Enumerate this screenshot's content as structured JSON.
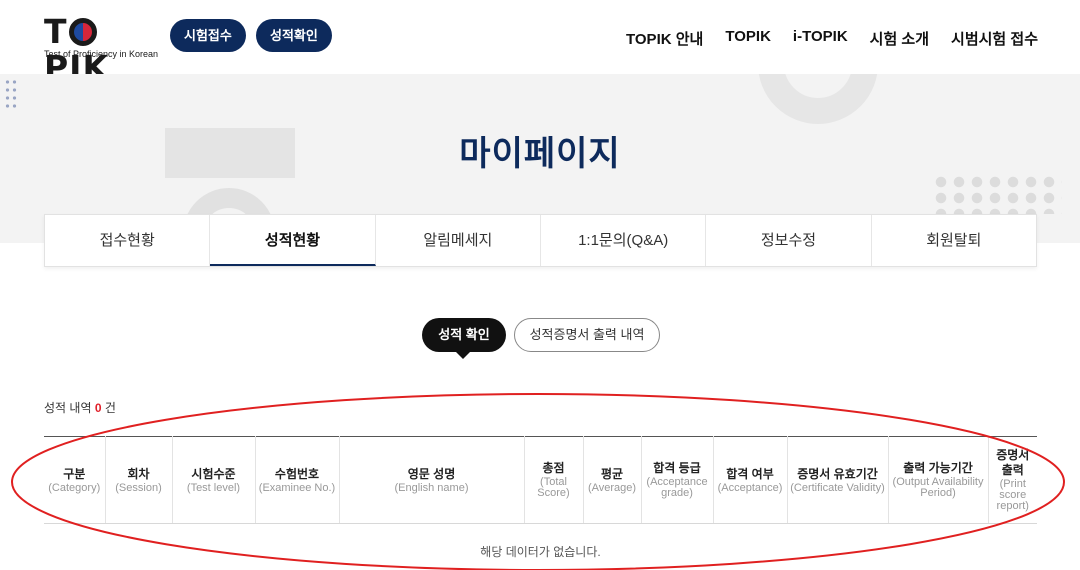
{
  "header": {
    "logo_word_pre": "T",
    "logo_word_post": "PIK",
    "logo_sub": "Test of Proficiency in Korean",
    "buttons": [
      "시험접수",
      "성적확인"
    ],
    "nav": [
      "TOPIK 안내",
      "TOPIK",
      "i-TOPIK",
      "시험 소개",
      "시범시험 접수"
    ]
  },
  "banner": {
    "title": "마이페이지"
  },
  "tabs": [
    {
      "label": "접수현황",
      "active": false
    },
    {
      "label": "성적현황",
      "active": true
    },
    {
      "label": "알림메세지",
      "active": false
    },
    {
      "label": "1:1문의(Q&A)",
      "active": false
    },
    {
      "label": "정보수정",
      "active": false
    },
    {
      "label": "회원탈퇴",
      "active": false
    }
  ],
  "toggle": {
    "active": "성적 확인",
    "inactive": "성적증명서 출력 내역"
  },
  "count": {
    "prefix": "성적 내역",
    "value": "0",
    "suffix": "건"
  },
  "table": {
    "columns": [
      {
        "ko": "구분",
        "en": "(Category)"
      },
      {
        "ko": "회차",
        "en": "(Session)"
      },
      {
        "ko": "시험수준",
        "en": "(Test level)"
      },
      {
        "ko": "수험번호",
        "en": "(Examinee No.)"
      },
      {
        "ko": "영문 성명",
        "en": "(English name)"
      },
      {
        "ko": "총점",
        "en": "(Total Score)"
      },
      {
        "ko": "평균",
        "en": "(Average)"
      },
      {
        "ko": "합격 등급",
        "en": "(Acceptance grade)"
      },
      {
        "ko": "합격 여부",
        "en": "(Acceptance)"
      },
      {
        "ko": "증명서 유효기간",
        "en": "(Certificate Validity)"
      },
      {
        "ko": "출력 가능기간",
        "en": "(Output Availability Period)"
      },
      {
        "ko": "증명서 출력",
        "en": "(Print score report)"
      }
    ],
    "empty_message": "해당 데이터가 없습니다."
  },
  "colors": {
    "navy": "#0d2a5c",
    "highlight_red": "#e0202a",
    "annotation_red": "#e02020"
  }
}
